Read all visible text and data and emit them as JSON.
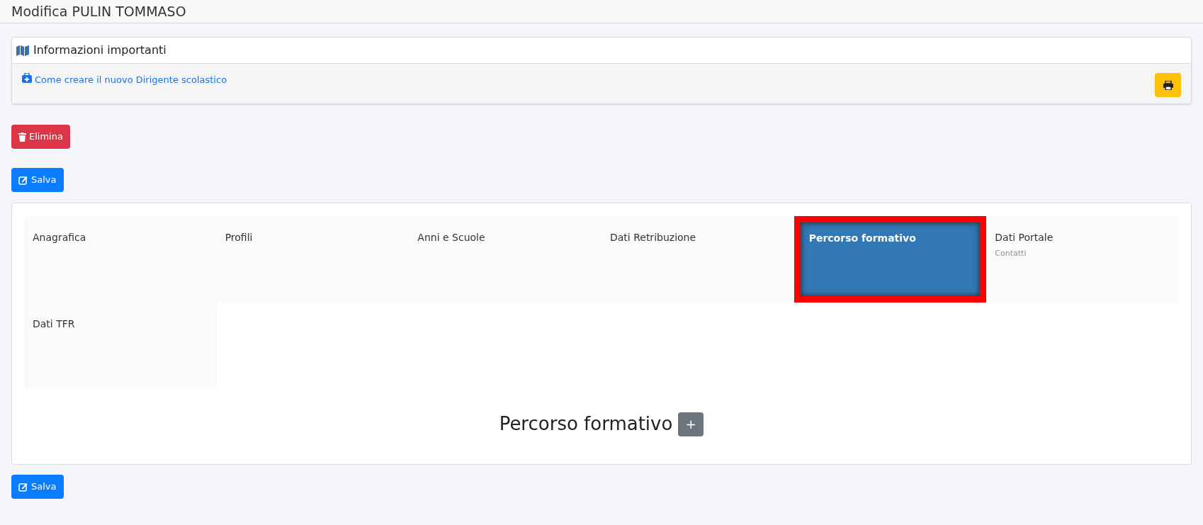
{
  "page_title": "Modifica PULIN TOMMASO",
  "info_panel": {
    "title": "Informazioni importanti",
    "link": "Come creare il nuovo Dirigente scolastico"
  },
  "delete_button": "Elimina",
  "save_button_top": "Salva",
  "tabs": [
    {
      "label": "Anagrafica",
      "selected": false
    },
    {
      "label": "Profili",
      "selected": false
    },
    {
      "label": "Anni e Scuole",
      "selected": false
    },
    {
      "label": "Dati Retribuzione",
      "selected": false
    },
    {
      "label": "Percorso formativo",
      "selected": true
    },
    {
      "label": "Dati Portale",
      "subtitle": "Contatti",
      "selected": false
    },
    {
      "label": "Dati TFR",
      "selected": false
    }
  ],
  "section": {
    "title": "Percorso formativo",
    "add_button": "+"
  },
  "save_button_bottom": "Salva"
}
